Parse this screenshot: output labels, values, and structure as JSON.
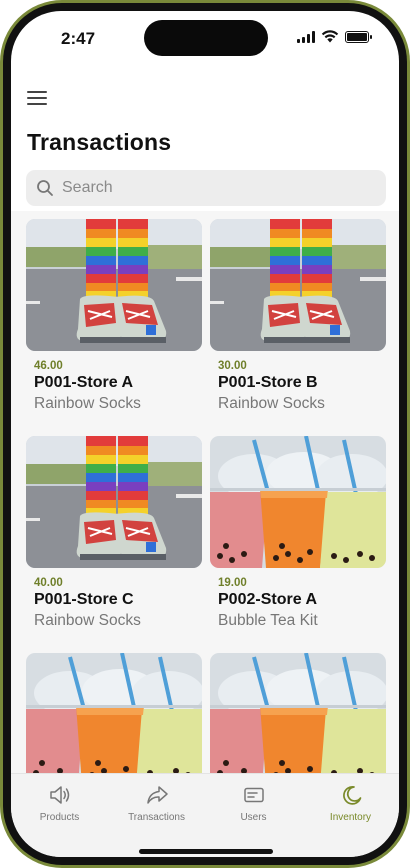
{
  "status_bar": {
    "time": "2:47"
  },
  "header": {
    "title": "Transactions",
    "search": {
      "placeholder": "Search",
      "value": ""
    }
  },
  "products": [
    {
      "price": "46.00",
      "title": "P001-Store A",
      "subtitle": "Rainbow Socks",
      "image": "rainbow-socks"
    },
    {
      "price": "30.00",
      "title": "P001-Store B",
      "subtitle": "Rainbow Socks",
      "image": "rainbow-socks"
    },
    {
      "price": "40.00",
      "title": "P001-Store C",
      "subtitle": "Rainbow Socks",
      "image": "rainbow-socks"
    },
    {
      "price": "19.00",
      "title": "P002-Store A",
      "subtitle": "Bubble Tea Kit",
      "image": "bubble-tea"
    },
    {
      "price": "",
      "title": "",
      "subtitle": "",
      "image": "bubble-tea"
    },
    {
      "price": "",
      "title": "",
      "subtitle": "",
      "image": "bubble-tea"
    }
  ],
  "tab_bar": {
    "items": [
      {
        "label": "Products",
        "icon": "speaker-icon",
        "active": false
      },
      {
        "label": "Transactions",
        "icon": "share-arrow-icon",
        "active": false
      },
      {
        "label": "Users",
        "icon": "card-icon",
        "active": false
      },
      {
        "label": "Inventory",
        "icon": "moon-icon",
        "active": true
      }
    ]
  },
  "colors": {
    "accent": "#7a8a2a",
    "frame": "#7a8a3a",
    "price": "#6f7f2a"
  }
}
